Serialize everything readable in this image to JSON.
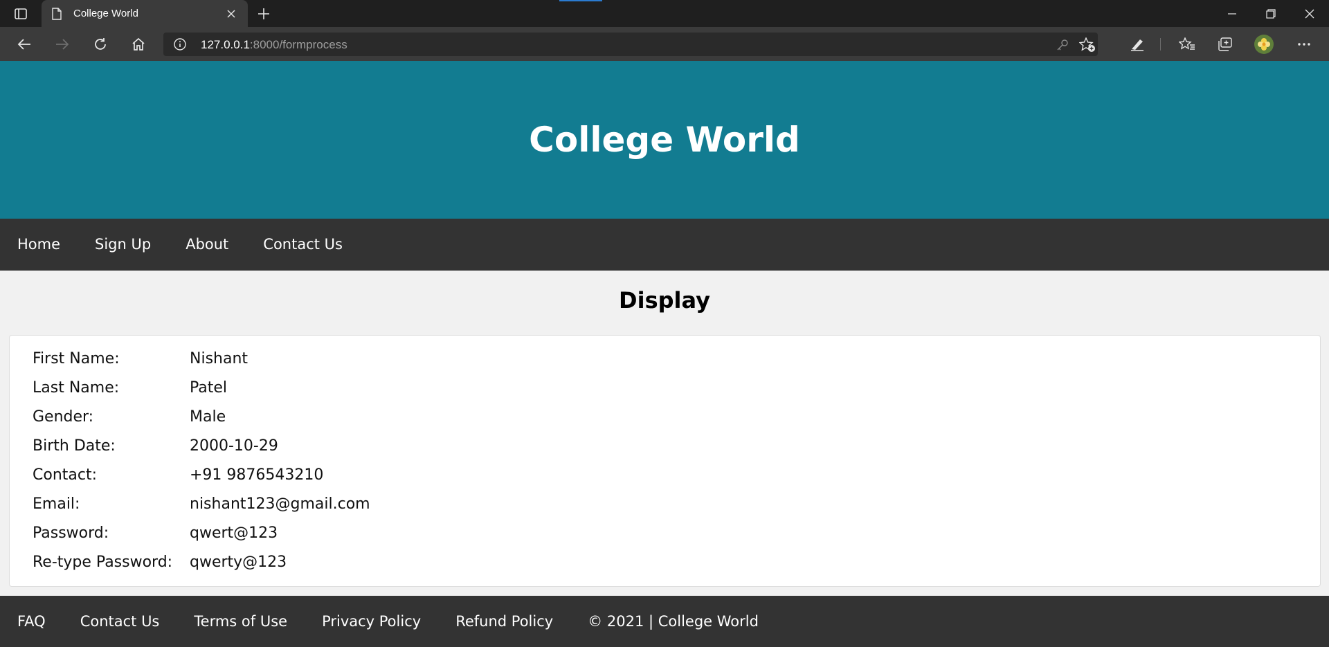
{
  "browser": {
    "tab_title": "College World",
    "url_host": "127.0.0.1",
    "url_rest": ":8000/formprocess"
  },
  "site": {
    "title": "College World",
    "accent_color": "#127c91",
    "nav_bg": "#333333"
  },
  "nav": {
    "items": [
      {
        "label": "Home"
      },
      {
        "label": "Sign Up"
      },
      {
        "label": "About"
      },
      {
        "label": "Contact Us"
      }
    ]
  },
  "main": {
    "heading": "Display",
    "rows": [
      {
        "label": "First Name:",
        "value": "Nishant"
      },
      {
        "label": "Last Name:",
        "value": "Patel"
      },
      {
        "label": "Gender:",
        "value": "Male"
      },
      {
        "label": "Birth Date:",
        "value": "2000-10-29"
      },
      {
        "label": "Contact:",
        "value": "+91 9876543210"
      },
      {
        "label": "Email:",
        "value": "nishant123@gmail.com"
      },
      {
        "label": "Password:",
        "value": "qwert@123"
      },
      {
        "label": "Re-type Password:",
        "value": "qwerty@123"
      }
    ]
  },
  "footer": {
    "links": [
      {
        "label": "FAQ"
      },
      {
        "label": "Contact Us"
      },
      {
        "label": "Terms of Use"
      },
      {
        "label": "Privacy Policy"
      },
      {
        "label": "Refund Policy"
      }
    ],
    "copyright": "© 2021 | College World"
  }
}
